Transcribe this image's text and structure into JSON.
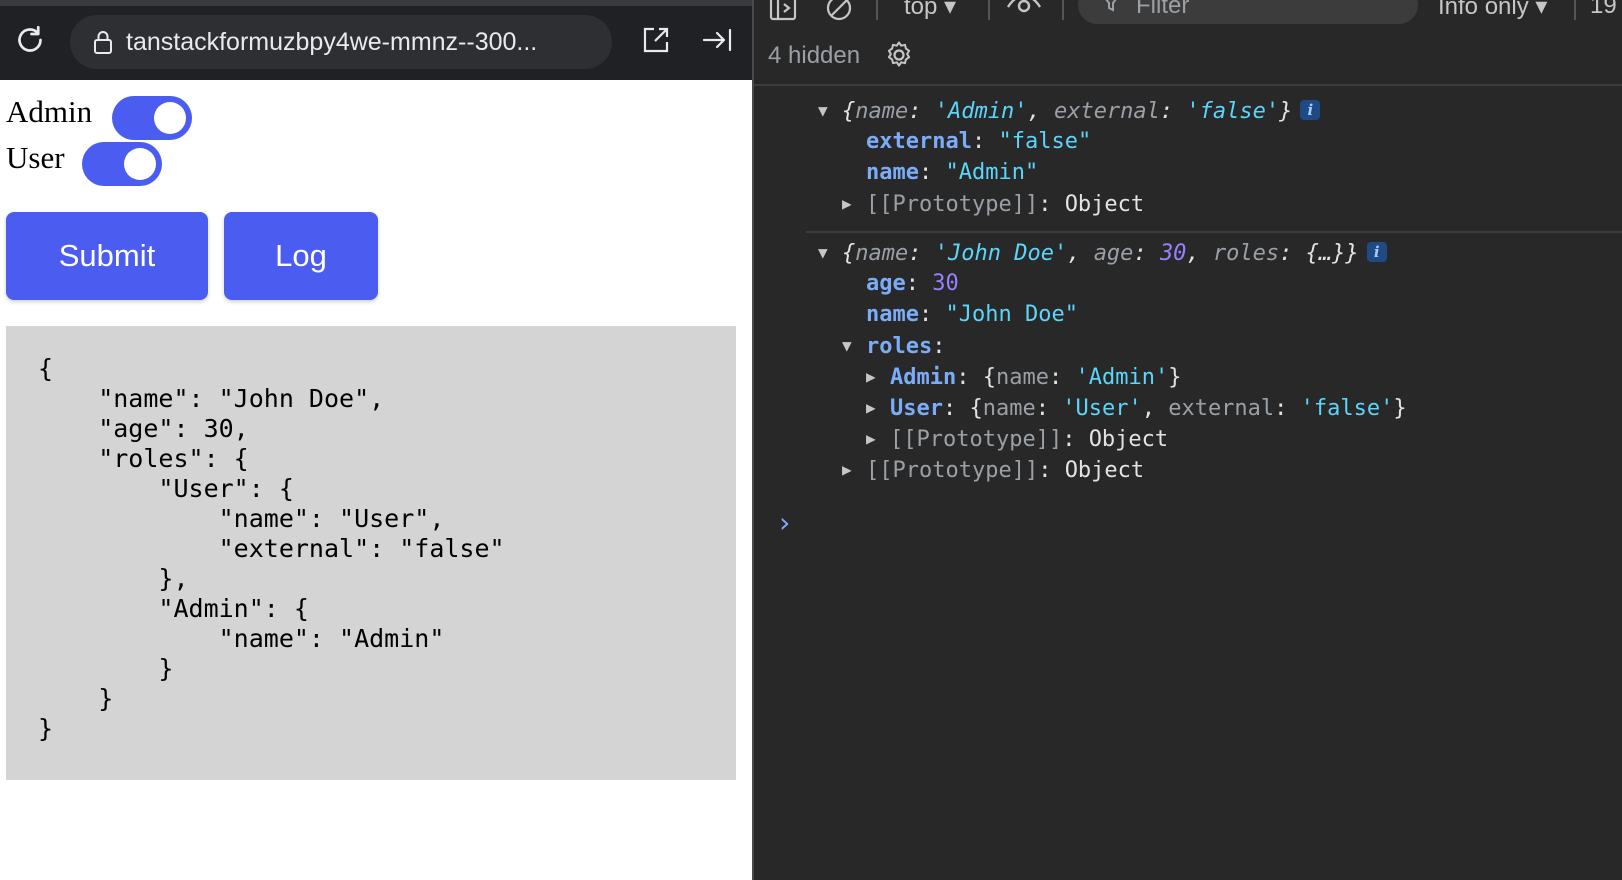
{
  "browser": {
    "url": "tanstackformuzbpy4we-mmnz--300..."
  },
  "form": {
    "toggles": [
      {
        "label": "Admin",
        "checked": true
      },
      {
        "label": "User",
        "checked": true
      }
    ],
    "submit_label": "Submit",
    "log_label": "Log",
    "json_output": "{\n    \"name\": \"John Doe\",\n    \"age\": 30,\n    \"roles\": {\n        \"User\": {\n            \"name\": \"User\",\n            \"external\": \"false\"\n        },\n        \"Admin\": {\n            \"name\": \"Admin\"\n        }\n    }\n}"
  },
  "devtools": {
    "context": "top",
    "filter_placeholder": "Filter",
    "levels": "Info only",
    "count": "19",
    "hidden": "4 hidden",
    "log1": {
      "name_key": "name",
      "name_val": "'Admin'",
      "external_key": "external",
      "external_val": "'false'",
      "info": "i",
      "prop1_key": "external",
      "prop1_val": "\"false\"",
      "prop2_key": "name",
      "prop2_val": "\"Admin\"",
      "proto_key": "[[Prototype]]",
      "proto_val": "Object"
    },
    "log2": {
      "name_key": "name",
      "name_val": "'John Doe'",
      "age_key": "age",
      "age_val": "30",
      "roles_key": "roles",
      "roles_val": "{…}",
      "info": "i",
      "p_age_key": "age",
      "p_age_val": "30",
      "p_name_key": "name",
      "p_name_val": "\"John Doe\"",
      "p_roles_key": "roles",
      "admin_key": "Admin",
      "admin_name_key": "name",
      "admin_name_val": "'Admin'",
      "user_key": "User",
      "user_name_key": "name",
      "user_name_val": "'User'",
      "user_ext_key": "external",
      "user_ext_val": "'false'",
      "inner_proto_key": "[[Prototype]]",
      "inner_proto_val": "Object",
      "proto_key": "[[Prototype]]",
      "proto_val": "Object"
    }
  }
}
